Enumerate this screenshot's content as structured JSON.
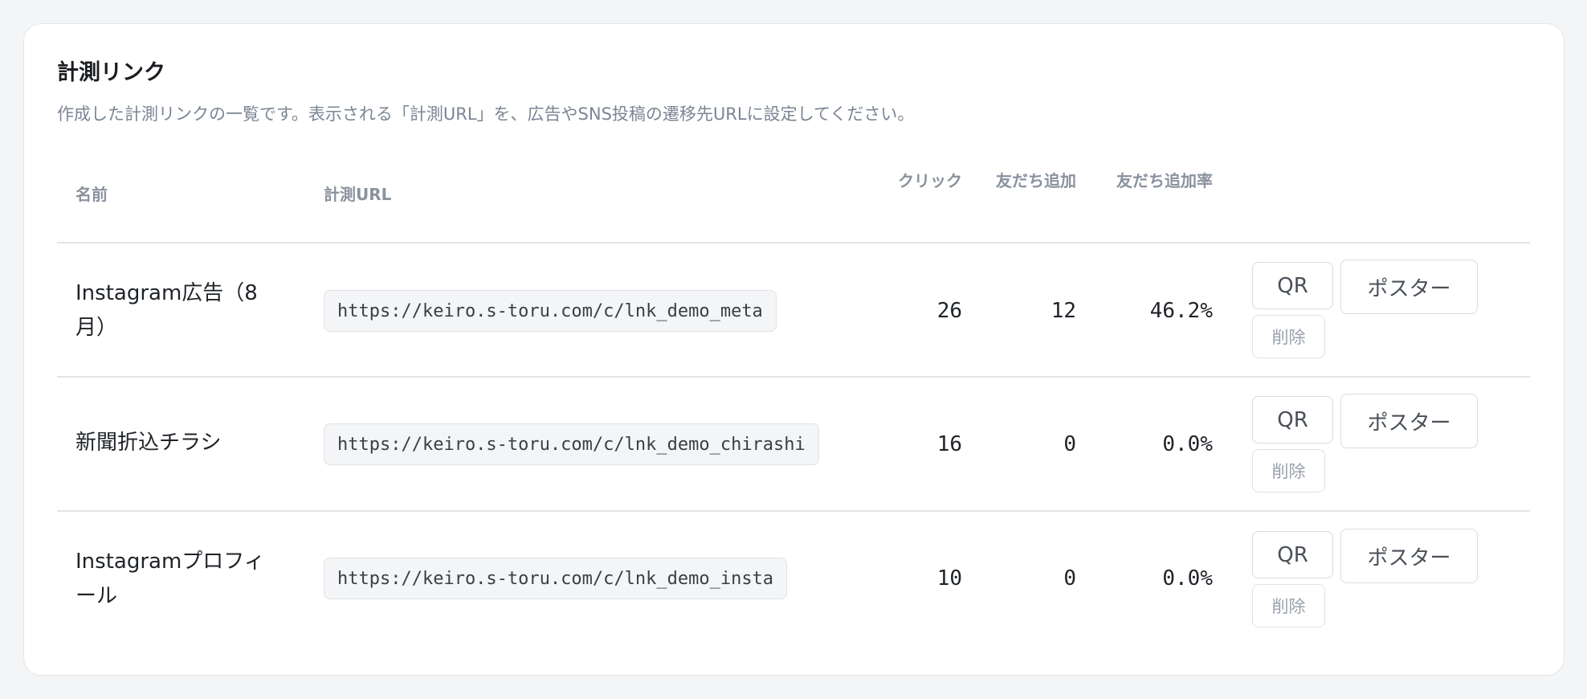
{
  "card": {
    "title": "計測リンク",
    "description": "作成した計測リンクの一覧です。表示される「計測URL」を、広告やSNS投稿の遷移先URLに設定してください。"
  },
  "table": {
    "headers": {
      "name": "名前",
      "url": "計測URL",
      "clicks": "クリック",
      "friends_added": "友だち追加",
      "friend_rate": "友だち追加率"
    },
    "rows": [
      {
        "name": "Instagram広告（8月）",
        "url": "https://keiro.s-toru.com/c/lnk_demo_meta",
        "clicks": "26",
        "friends_added": "12",
        "friend_rate": "46.2%"
      },
      {
        "name": "新聞折込チラシ",
        "url": "https://keiro.s-toru.com/c/lnk_demo_chirashi",
        "clicks": "16",
        "friends_added": "0",
        "friend_rate": "0.0%"
      },
      {
        "name": "Instagramプロフィール",
        "url": "https://keiro.s-toru.com/c/lnk_demo_insta",
        "clicks": "10",
        "friends_added": "0",
        "friend_rate": "0.0%"
      }
    ],
    "actions": {
      "qr_label": "QR",
      "poster_label": "ポスター",
      "delete_label": "削除"
    }
  }
}
